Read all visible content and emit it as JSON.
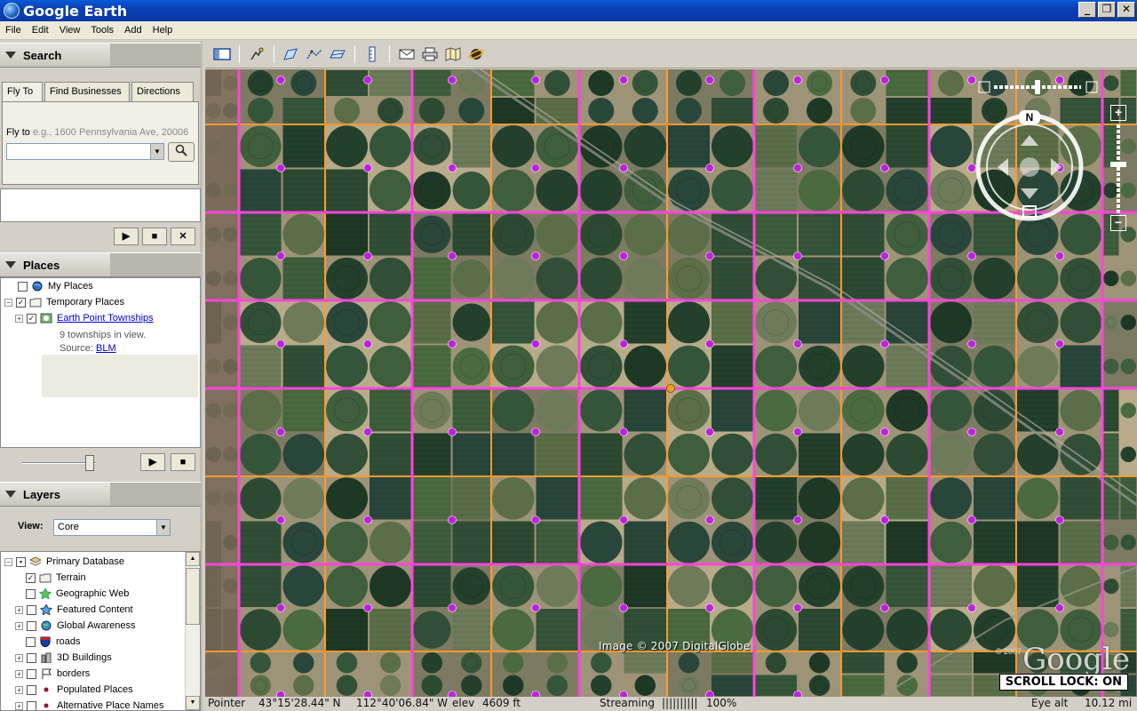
{
  "window": {
    "title": "Google Earth",
    "buttons": [
      "_",
      "❐",
      "✕"
    ]
  },
  "menu": [
    "File",
    "Edit",
    "View",
    "Tools",
    "Add",
    "Help"
  ],
  "search": {
    "header": "Search",
    "tabs": [
      "Fly To",
      "Find Businesses",
      "Directions"
    ],
    "flyto_label": "Fly to",
    "flyto_example": "e.g., 1600 Pennsylvania Ave, 20006",
    "flyto_value": "",
    "controls": [
      "▶",
      "■",
      "✕"
    ]
  },
  "places": {
    "header": "Places",
    "items": [
      {
        "label": "My Places",
        "checked": false
      },
      {
        "label": "Temporary Places",
        "checked": true
      },
      {
        "label": "Earth Point Townships",
        "checked": true
      }
    ],
    "desc_line1": "9 townships in view.",
    "desc_source_label": "Source:",
    "desc_source_link": "BLM",
    "controls": [
      "▶",
      "■"
    ]
  },
  "layers": {
    "header": "Layers",
    "view_label": "View:",
    "view_value": "Core",
    "items": [
      {
        "label": "Primary Database",
        "checked": true
      },
      {
        "label": "Terrain",
        "checked": true
      },
      {
        "label": "Geographic Web",
        "checked": false
      },
      {
        "label": "Featured Content",
        "checked": false
      },
      {
        "label": "Global Awareness",
        "checked": false
      },
      {
        "label": "roads",
        "checked": false
      },
      {
        "label": "3D Buildings",
        "checked": false
      },
      {
        "label": "borders",
        "checked": false
      },
      {
        "label": "Populated Places",
        "checked": false
      },
      {
        "label": "Alternative Place Names",
        "checked": false
      }
    ]
  },
  "map": {
    "image_credit": "Image © 2007 DigitalGlobe",
    "copyright_small": "© 2007",
    "logo": "Google",
    "scroll_lock": "SCROLL LOCK: ON",
    "compass_letter": "N"
  },
  "status": {
    "pointer_label": "Pointer",
    "lat": "43°15'28.44\" N",
    "lon": "112°40'06.84\" W",
    "elev_label": "elev",
    "elev": "4609 ft",
    "streaming_label": "Streaming",
    "streaming_bar": "||||||||||",
    "streaming_pct": "100%",
    "eye_label": "Eye alt",
    "eye_alt": "10.12 mi"
  },
  "colors": {
    "township_lines": "#ff44dd",
    "section_lines": "#ff9a2e",
    "markers": "#c020e0",
    "title_bar": "#0b3fb4"
  }
}
